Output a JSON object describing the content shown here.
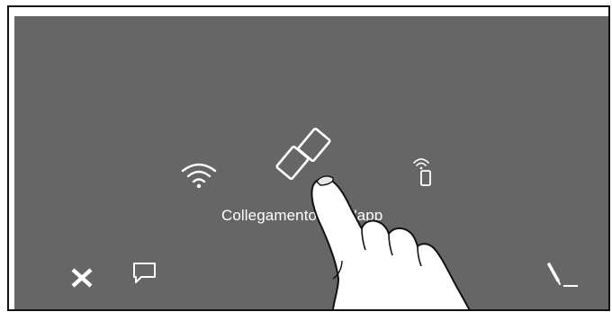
{
  "screen": {
    "label": "Collegamento con l'app",
    "icons": {
      "wifi": "wifi-icon",
      "app_link": "link-icon",
      "remote_start": "remote-phone-icon",
      "close": "close-icon",
      "message": "message-icon",
      "edit": "pen-icon"
    },
    "colors": {
      "background": "#666666",
      "foreground": "#ffffff"
    }
  }
}
